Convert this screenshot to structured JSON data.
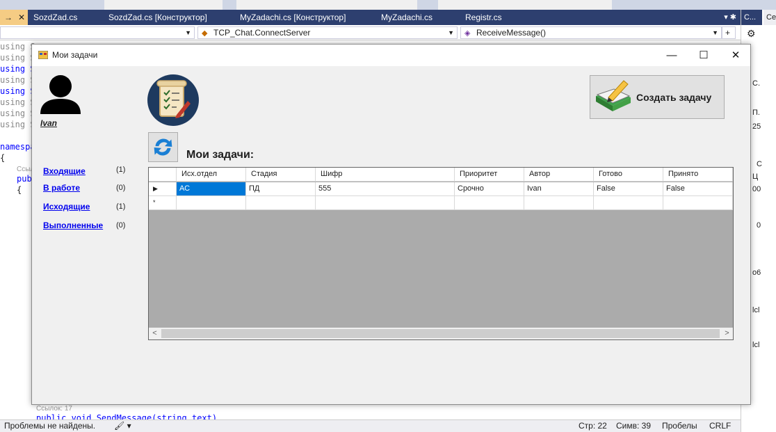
{
  "vs": {
    "tabs": [
      {
        "label": "→",
        "close": "✕"
      },
      {
        "label": "SozdZad.cs"
      },
      {
        "label": "SozdZad.cs [Конструктор]"
      },
      {
        "label": "MyZadachi.cs [Конструктор]"
      },
      {
        "label": "MyZadachi.cs"
      },
      {
        "label": "Registr.cs"
      }
    ],
    "nav_member": "TCP_Chat.ConnectServer",
    "nav_method": "ReceiveMessage()",
    "code": {
      "using": "using S",
      "namespace": "namespa",
      "refs": "Ссыл",
      "pub": "pub",
      "brace_open": "{",
      "refs_17": "Ссылок: 17",
      "send_message": "public void SendMessage(string text)"
    },
    "right_panel": {
      "tab_label": "C...",
      "tab_label2": "Ce",
      "lines": [
        "C.",
        "П.",
        "25",
        "C",
        "Ц",
        "00",
        "0",
        "o6",
        "с",
        "lcl",
        "lcl"
      ]
    },
    "status": {
      "problems": "Проблемы не найдены.",
      "line": "Стр: 22",
      "col": "Симв: 39",
      "spaces": "Пробелы",
      "eol": "CRLF"
    }
  },
  "window": {
    "title": "Мои задачи",
    "user_name": "Ivan",
    "heading": "Мои задачи:",
    "create_button": "Создать задачу",
    "nav": [
      {
        "label": "Входящие",
        "count": "(1)"
      },
      {
        "label": "В работе",
        "count": "(0)"
      },
      {
        "label": "Исходящие",
        "count": "(1)"
      },
      {
        "label": "Выполненные",
        "count": "(0)"
      }
    ],
    "grid": {
      "columns": [
        "Исх.отдел",
        "Стадия",
        "Шифр",
        "Приоритет",
        "Автор",
        "Готово",
        "Принято"
      ],
      "rows": [
        {
          "marker": "▶",
          "cells": [
            "АС",
            "ПД",
            "555",
            "Срочно",
            "Ivan",
            "False",
            "False"
          ]
        }
      ],
      "new_row_marker": "*"
    }
  }
}
